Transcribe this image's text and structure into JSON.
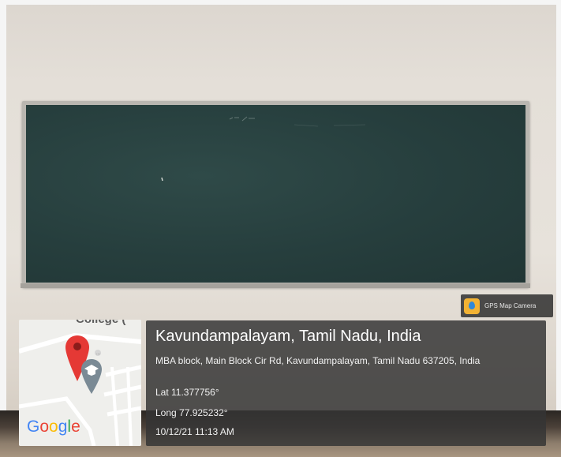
{
  "badge": {
    "text": "GPS Map Camera",
    "icon": "gps-map-camera-icon"
  },
  "location": {
    "title": "Kavundampalayam, Tamil Nadu, India",
    "address": "MBA block, Main Block Cir Rd, Kavundampalayam, Tamil Nadu 637205, India",
    "lat": "Lat 11.377756°",
    "long": "Long 77.925232°",
    "datetime": "10/12/21 11:13 AM"
  },
  "map": {
    "label": "College (",
    "logo": "Google",
    "pin_icon": "map-pin-icon",
    "school_icon": "school-icon"
  },
  "colors": {
    "pin": "#e53935",
    "board": "#263e3d",
    "panel": "#343434",
    "badge_icon": "#f2b233"
  }
}
